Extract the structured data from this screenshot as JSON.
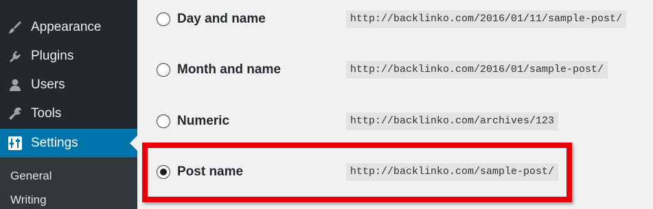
{
  "sidebar": {
    "items": [
      {
        "label": "Appearance",
        "icon": "paintbrush-icon"
      },
      {
        "label": "Plugins",
        "icon": "plug-icon"
      },
      {
        "label": "Users",
        "icon": "user-icon"
      },
      {
        "label": "Tools",
        "icon": "wrench-icon"
      },
      {
        "label": "Settings",
        "icon": "settings-icon",
        "active": true
      }
    ],
    "submenu": [
      {
        "label": "General"
      },
      {
        "label": "Writing"
      }
    ]
  },
  "permalinks": {
    "options": [
      {
        "label": "Day and name",
        "example": "http://backlinko.com/2016/01/11/sample-post/",
        "checked": false
      },
      {
        "label": "Month and name",
        "example": "http://backlinko.com/2016/01/sample-post/",
        "checked": false
      },
      {
        "label": "Numeric",
        "example": "http://backlinko.com/archives/123",
        "checked": false
      },
      {
        "label": "Post name",
        "example": "http://backlinko.com/sample-post/",
        "checked": true
      }
    ]
  },
  "colors": {
    "sidebar_bg": "#23282d",
    "active_bg": "#0073aa",
    "highlight": "#e8000b",
    "content_bg": "#f1f1f1"
  }
}
